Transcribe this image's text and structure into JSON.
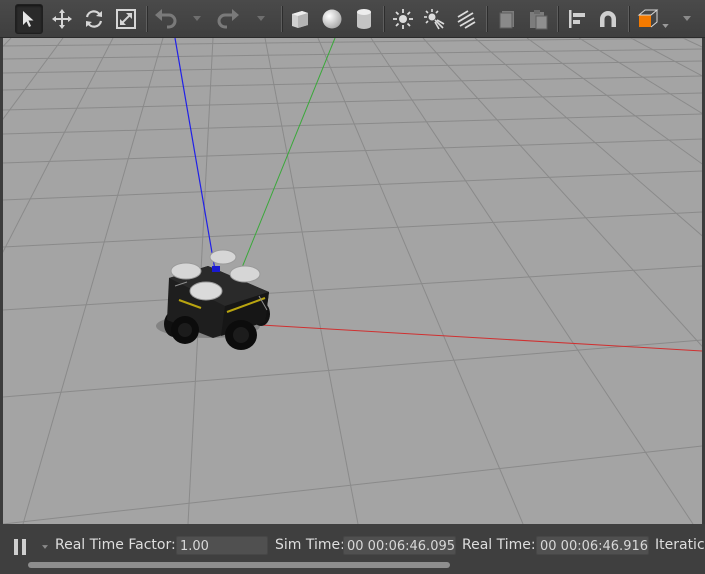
{
  "toolbar": {
    "tools": [
      {
        "name": "select-mode",
        "icon": "arrow-cursor-icon",
        "active": true
      },
      {
        "name": "translate-mode",
        "icon": "move-arrows-icon"
      },
      {
        "name": "rotate-mode",
        "icon": "rotate-icon"
      },
      {
        "name": "scale-mode",
        "icon": "scale-icon"
      },
      {
        "name": "undo",
        "icon": "undo-icon"
      },
      {
        "name": "redo",
        "icon": "redo-icon"
      },
      {
        "name": "box-shape",
        "icon": "box-icon"
      },
      {
        "name": "sphere-shape",
        "icon": "sphere-icon"
      },
      {
        "name": "cylinder-shape",
        "icon": "cylinder-icon"
      },
      {
        "name": "point-light",
        "icon": "sun-icon"
      },
      {
        "name": "spot-light",
        "icon": "spotlight-icon"
      },
      {
        "name": "directional-light",
        "icon": "directional-light-icon"
      },
      {
        "name": "copy",
        "icon": "copy-icon"
      },
      {
        "name": "paste",
        "icon": "paste-icon"
      },
      {
        "name": "align",
        "icon": "align-icon"
      },
      {
        "name": "snap",
        "icon": "magnet-icon"
      },
      {
        "name": "view-angle",
        "icon": "orange-cube-icon"
      }
    ],
    "colors": {
      "view_angle_accent": "#f47a00"
    }
  },
  "scene": {
    "background": "#a4a4a4",
    "grid_color": "#8e8e8e",
    "axes": {
      "x": "#d03030",
      "y": "#3aa83a",
      "z": "#2020e8"
    },
    "model": "robot-vehicle"
  },
  "status": {
    "pause_icon": "pause-icon",
    "real_time_factor_label": "Real Time Factor:",
    "real_time_factor_value": "1.00",
    "sim_time_label": "Sim Time:",
    "sim_time_value": "00 00:06:46.095",
    "real_time_label": "Real Time:",
    "real_time_value": "00 00:06:46.916",
    "iterations_label": "Iteratic"
  }
}
